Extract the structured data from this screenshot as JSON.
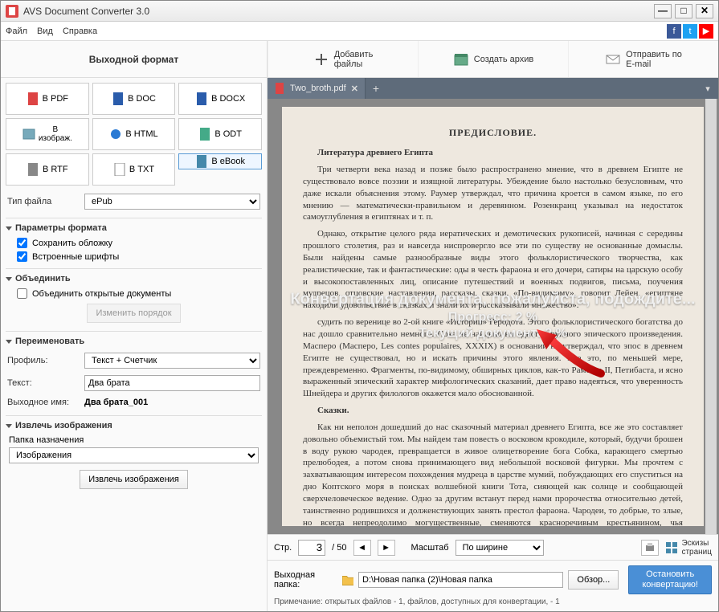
{
  "window": {
    "title": "AVS Document Converter 3.0"
  },
  "menu": {
    "file": "Файл",
    "view": "Вид",
    "help": "Справка"
  },
  "toolbar": {
    "leftlabel": "Выходной формат",
    "add": "Добавить\nфайлы",
    "archive": "Создать архив",
    "email": "Отправить по\nE-mail"
  },
  "formats": {
    "pdf": "В PDF",
    "doc": "В DOC",
    "docx": "В DOCX",
    "img": "В\nизображ.",
    "html": "В HTML",
    "odt": "В ODT",
    "rtf": "В RTF",
    "txt": "В TXT",
    "ebook": "В eBook"
  },
  "filetype": {
    "label": "Тип файла",
    "value": "ePub"
  },
  "sections": {
    "params": "Параметры формата",
    "keep_cover": "Сохранить обложку",
    "embed_fonts": "Встроенные шрифты",
    "merge": "Объединить",
    "merge_open": "Объединить открытые документы",
    "reorder": "Изменить порядок",
    "rename": "Переименовать",
    "profile_label": "Профиль:",
    "profile_value": "Текст + Счетчик",
    "text_label": "Текст:",
    "text_value": "Два брата",
    "outname_label": "Выходное имя:",
    "outname_value": "Два брата_001",
    "extract": "Извлечь изображения",
    "dest_label": "Папка назначения",
    "dest_value": "Изображения",
    "extract_btn": "Извлечь изображения"
  },
  "tab": {
    "name": "Two_broth.pdf"
  },
  "doc": {
    "pre_title": "ПРЕДИСЛОВИЕ.",
    "h1": "Литература древнего Египта",
    "p1": "Три четверти века назад и позже было распространено мнение, что в древнем Египте не существовало вовсе поэзии и изящной литературы. Убеждение было настолько безусловным, что даже искали объяснения этому. Раумер утверждал, что причина кроется в самом языке, по его мнению — математически-правильном и деревянном. Розенкранц указывал на недостаток самоуглубления в египтянах и т. п.",
    "p2": "Однако, открытие целого ряда иератических и демотических рукописей, начиная с середины прошлого столетия, раз и навсегда ниспровергло все эти по существу не основанные домыслы. Были найдены самые разнообразные виды этого фольклористического творчества, как реалистические, так и фантастические: оды в честь фараона и его дочери, сатиры на царскую особу и высокопоставленных лиц, описание путешествий и военных подвигов, письма, поучения мудрецов, отцовские наставления, рассказы, сказки. «По-видимому», говорит Лейен, «египтяне находили удовольствие в сказках и знали их и рассказывали множество».",
    "p3": "судить по веренице во 2-ой книге «Истории» Геродота. Этого фольклористического богатства до нас дошло сравнительно немного. Пока не найдено ни одного крупного эпического произведения. Масперо (Масперо, Les contes populaires, XXXIX) в основании не утверждал, что эпос в древнем Египте не существовал, но и искать причины этого явления. Все это, по меньшей мере, преждевременно. Фрагменты, по-видимому, обширных циклов, как-то Рамсеса II, Петибаста, и ясно выраженный эпический характер мифологических сказаний, дает право надеяться, что уверенность Шнейдера и других филологов окажется мало обоснованной.",
    "h2": "Сказки.",
    "p4": "Как ни неполон дошедший до нас сказочный материал древнего Египта, все же это составляет довольно объемистый том. Мы найдем там повесть о восковом крокодиле, который, будучи брошен в воду рукою чародея, превращается в живое олицетворение бога Собка, карающего смертью прелюбодея, а потом снова принимающего вид небольшой восковой фигурки. Мы прочтем с захватывающим интересом похождения мудреца в царстве мумий, побуждающих его спуститься на дно Коптского моря в поисках волшебной книги Тота, сияющей как солнце и сообщающей сверхчеловеческое ведение. Одно за другим встанут перед нами пророчества относительно детей, таинственно родившихся и долженствующих занять престол фараона. Чародеи, то добрые, то злые, но всегда непреодолимо могущественные, сменяются красноречивым крестьянином, чья напыщенная риторика, подогретая палочными ударами,"
  },
  "overlay": {
    "line1": "Конвертация документа, пожалуйста, подождите...",
    "line2": "Прогресс: 2 %",
    "line3": "Текущий документ: 2 %"
  },
  "pager": {
    "page_label": "Стр.",
    "page_cur": "3",
    "page_total": "/ 50",
    "zoom_label": "Масштаб",
    "zoom_value": "По ширине",
    "thumbs": "Эскизы\nстраниц"
  },
  "footer": {
    "out_label": "Выходная папка:",
    "out_value": "D:\\Новая папка (2)\\Новая папка",
    "browse": "Обзор...",
    "stop": "Остановить\nконвертацию!",
    "note": "Примечание: открытых файлов - 1, файлов, доступных для конвертации, - 1"
  }
}
